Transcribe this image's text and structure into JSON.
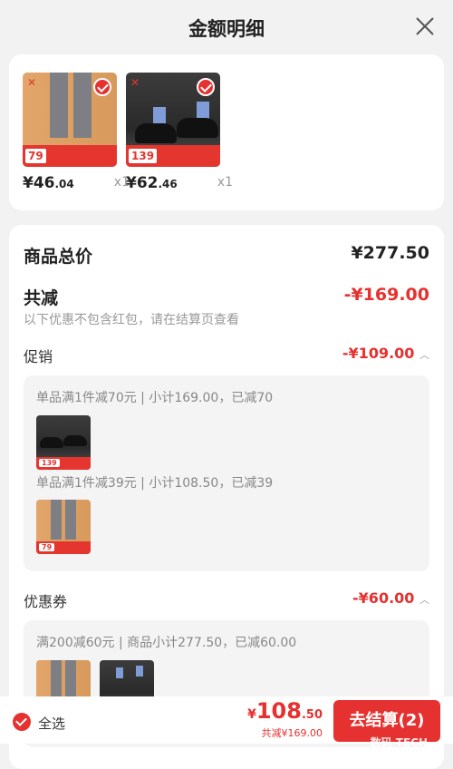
{
  "header": {
    "title": "金额明细"
  },
  "products": [
    {
      "banner_price": "79",
      "price_int": "¥46",
      "price_dec": ".04",
      "qty": "x1"
    },
    {
      "banner_price": "139",
      "price_int": "¥62",
      "price_dec": ".46",
      "qty": "x1"
    }
  ],
  "summary": {
    "total_label": "商品总价",
    "total_value": "¥277.50",
    "discount_label": "共减",
    "discount_value": "-¥169.00",
    "note": "以下优惠不包含红包，请在结算页查看"
  },
  "promotion": {
    "label": "促销",
    "value": "-¥109.00",
    "rules": [
      "单品满1件减70元 | 小计169.00，已减70",
      "单品满1件减39元 | 小计108.50，已减39"
    ]
  },
  "coupon": {
    "label": "优惠券",
    "value": "-¥60.00",
    "rule": "满200减60元 | 商品小计277.50，已减60.00"
  },
  "bottom": {
    "select_all": "全选",
    "yen": "¥",
    "total_int": "108",
    "total_dec": ".50",
    "total_sub": "共减¥169.00",
    "pay_label": "去结算(2)",
    "watermark": "数码   TECH"
  },
  "colors": {
    "accent": "#e5312f",
    "background": "#f2f2f2"
  }
}
